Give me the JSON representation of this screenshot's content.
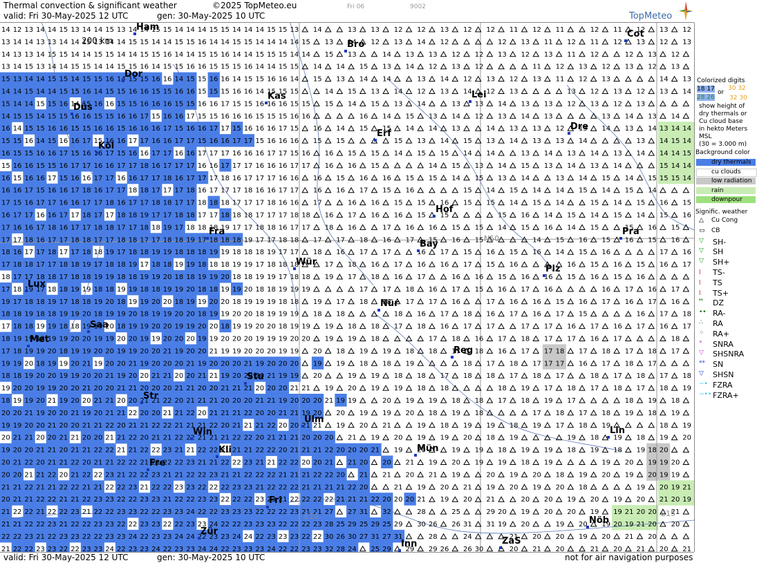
{
  "header": {
    "title": "Thermal convection & significant weather",
    "copyright": "©2025 TopMeteo.eu",
    "valid": "valid:  Fri  30-May-2025  12 UTC",
    "generated": "gen:  30-May-2025 10 UTC",
    "small_day": "Fri 06",
    "small_code": "9002",
    "logo": "TopMeteo"
  },
  "footer": {
    "valid": "valid:  Fri  30-May-2025  12 UTC",
    "generated": "gen:  30-May-2025 10 UTC",
    "disclaimer": "not for air navigation purposes"
  },
  "map": {
    "scale_label": "200 km",
    "grid_labels": [
      "E10",
      "E15",
      "N50"
    ],
    "cities": [
      "Ham",
      "Cot",
      "Bro",
      "Dor",
      "Kas",
      "Lei",
      "Düs",
      "Erf",
      "Dre",
      "Köl",
      "Hof",
      "Pra",
      "Fra",
      "Bay",
      "Wür",
      "Plz",
      "Lux",
      "Nür",
      "Saa",
      "Met",
      "Reg",
      "Stu",
      "Str",
      "Ulm",
      "Win",
      "Lin",
      "Kli",
      "Mün",
      "Fre",
      "Fri",
      "Nöb",
      "Zür",
      "ZaS",
      "Inn"
    ]
  },
  "legend": {
    "colorized_title": [
      "Colorized digits",
      "show height of",
      "dry thermals or",
      "Cu cloud base",
      "in hekto Meters",
      "MSL",
      "(30 = 3.000 m)"
    ],
    "digit_examples": [
      "18 17",
      "or",
      "30 32",
      "28 26",
      "32 30"
    ],
    "background_title": "Background color",
    "background_items": [
      {
        "label": "dry thermals",
        "color": "#4a7ee6"
      },
      {
        "label": "cu clouds",
        "color": "#ffffff"
      },
      {
        "label": "low radiation",
        "color": "#c8c8c8"
      },
      {
        "label": "rain",
        "color": "#c8ecb4"
      },
      {
        "label": "downpour",
        "color": "#9ee07e"
      }
    ],
    "signific_title": "Signific. weather",
    "signific_items": [
      {
        "label": "Cu Cong",
        "symbol": "△",
        "color": "#000000"
      },
      {
        "label": "CB",
        "symbol": "▭",
        "color": "#000000"
      },
      {
        "label": "SH-",
        "symbol": "▽",
        "color": "#1a9a1a"
      },
      {
        "label": "SH",
        "symbol": "▽",
        "color": "#1a9a1a"
      },
      {
        "label": "SH+",
        "symbol": "▽",
        "color": "#1a9a1a"
      },
      {
        "label": "TS-",
        "symbol": "ꞁ",
        "color": "#cc2222"
      },
      {
        "label": "TS",
        "symbol": "ꞁ",
        "color": "#cc2222"
      },
      {
        "label": "TS+",
        "symbol": "ꞁ",
        "color": "#cc2222"
      },
      {
        "label": "DZ",
        "symbol": "❜❜",
        "color": "#1a6a1a"
      },
      {
        "label": "RA-",
        "symbol": "••",
        "color": "#1a6a1a"
      },
      {
        "label": "RA",
        "symbol": "∴",
        "color": "#1a6a1a"
      },
      {
        "label": "RA+",
        "symbol": "⁘",
        "color": "#1a6a1a"
      },
      {
        "label": "SNRA",
        "symbol": "*",
        "color": "#cc44cc"
      },
      {
        "label": "SHSNRA",
        "symbol": "▽",
        "color": "#cc44cc"
      },
      {
        "label": "SN",
        "symbol": "**",
        "color": "#2244cc"
      },
      {
        "label": "SHSN",
        "symbol": "▽",
        "color": "#2244cc"
      },
      {
        "label": "FZRA",
        "symbol": "~•",
        "color": "#22c8e8"
      },
      {
        "label": "FZRA+",
        "symbol": "~••",
        "color": "#22c8e8"
      }
    ]
  }
}
